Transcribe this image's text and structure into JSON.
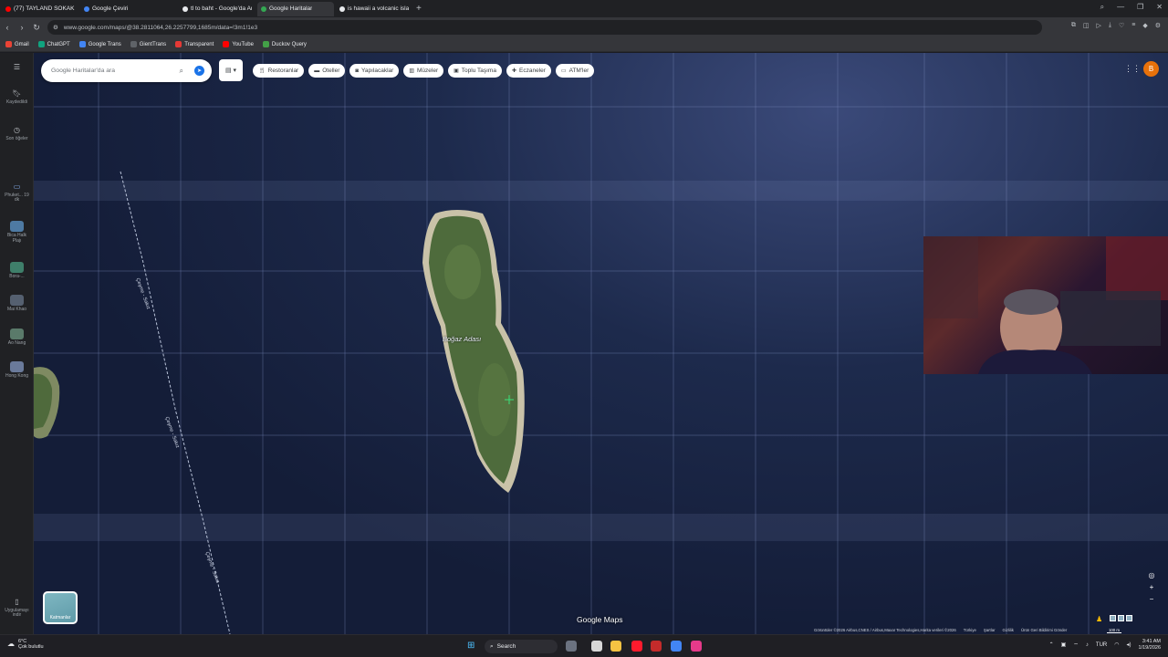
{
  "tabs": [
    {
      "title": "(77) TAYLAND SOKAK LEZ",
      "icon": "youtube-icon",
      "color": "#ff0000",
      "active": false
    },
    {
      "title": "Google Çeviri",
      "icon": "translate-icon",
      "color": "#4285f4",
      "active": false
    },
    {
      "title": "tl to baht - Google'da Ara",
      "icon": "google-icon",
      "color": "#e8eaed",
      "active": false
    },
    {
      "title": "Google Haritalar",
      "icon": "maps-icon",
      "color": "#34a853",
      "active": true
    },
    {
      "title": "is hawaii a volcanic island",
      "icon": "google-icon",
      "color": "#e8eaed",
      "active": false
    }
  ],
  "browser": {
    "url": "www.google.com/maps/@38.2811064,26.2257799,1685m/data=!3m1!1e3",
    "new_tab": "+"
  },
  "bookmarks": [
    {
      "label": "Gmail",
      "color": "#ea4335"
    },
    {
      "label": "ChatGPT",
      "color": "#10a37f"
    },
    {
      "label": "Google Trans",
      "color": "#4285f4"
    },
    {
      "label": "GientTrans",
      "color": "#5f6368"
    },
    {
      "label": "Transparent",
      "color": "#e53935"
    },
    {
      "label": "YouTube",
      "color": "#ff0000"
    },
    {
      "label": "Duckov Query",
      "color": "#43a047"
    }
  ],
  "rail": {
    "items": [
      {
        "label": "Kaydedildi",
        "icon": "bookmark-icon"
      },
      {
        "label": "Son öğeler",
        "icon": "history-icon"
      },
      {
        "label": "Phuket... 19 dk",
        "icon": "car-icon"
      },
      {
        "label": "Bica Halk Plajı",
        "icon": "place-thumb"
      },
      {
        "label": "Bora-...",
        "icon": "place-thumb"
      },
      {
        "label": "Mai Khao",
        "icon": "place-thumb"
      },
      {
        "label": "Ao Nang",
        "icon": "place-thumb"
      },
      {
        "label": "Hong Kong",
        "icon": "place-thumb"
      }
    ],
    "get_app": "Uygulamayı indir"
  },
  "search": {
    "placeholder": "Google Haritalar'da ara"
  },
  "chips": [
    {
      "label": "Restoranlar",
      "icon": "fork-knife-icon"
    },
    {
      "label": "Oteller",
      "icon": "bed-icon"
    },
    {
      "label": "Yapılacaklar",
      "icon": "camera-icon"
    },
    {
      "label": "Müzeler",
      "icon": "museum-icon"
    },
    {
      "label": "Toplu Taşıma",
      "icon": "train-icon"
    },
    {
      "label": "Eczaneler",
      "icon": "pharmacy-icon"
    },
    {
      "label": "ATM'ler",
      "icon": "atm-icon"
    }
  ],
  "avatar_letter": "B",
  "map": {
    "island_label": "Boğaz Adası",
    "route_labels": [
      "Çeşme - Sakız",
      "Çeşme - Sakız",
      "Çeşme - Sakız"
    ],
    "layers_label": "Katmanlar",
    "brand": "Google Maps",
    "attribution": [
      "Görüntüler ©2026 Airbus,CNES / Airbus,Maxar Technologies,Harita verileri ©2026",
      "Türkiye",
      "Şartlar",
      "Gizlilik",
      "Ürün Geri Bildirimi Gönder"
    ],
    "scale": "100 m"
  },
  "taskbar": {
    "weather_temp": "6°C",
    "weather_desc": "Çok bulutlu",
    "search_label": "Search",
    "lang": "TUR",
    "time": "3:41 AM",
    "date": "1/19/2026"
  }
}
